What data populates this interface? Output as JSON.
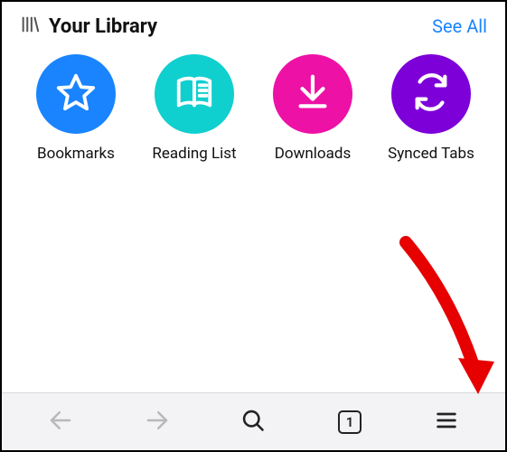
{
  "header": {
    "title": "Your Library",
    "see_all": "See All"
  },
  "tiles": [
    {
      "label": "Bookmarks",
      "color": "#1a84ff",
      "icon": "star"
    },
    {
      "label": "Reading List",
      "color": "#10cfcf",
      "icon": "book"
    },
    {
      "label": "Downloads",
      "color": "#ed11a6",
      "icon": "download"
    },
    {
      "label": "Synced Tabs",
      "color": "#7d00d9",
      "icon": "sync"
    }
  ],
  "toolbar": {
    "tab_count": "1"
  }
}
